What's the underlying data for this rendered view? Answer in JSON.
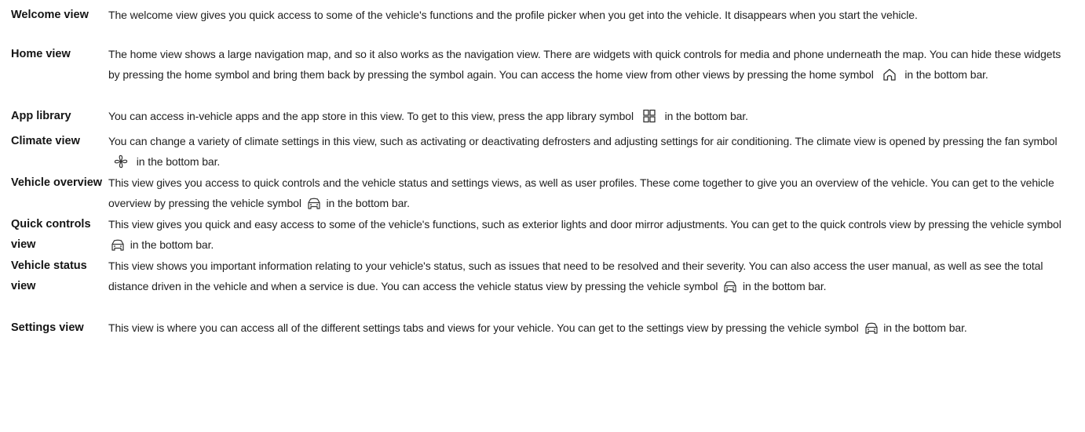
{
  "rows": [
    {
      "term": "Welcome view",
      "desc": "The welcome view gives you quick access to some of the vehicle's functions and the profile picker when you get into the vehicle. It disappears when you start the vehicle."
    },
    {
      "term": "Home view",
      "desc_before": "The home view shows a large navigation map, and so it also works as the navigation view. There are widgets with quick controls for media and phone underneath the map. You can hide these widgets by pressing the home symbol and bring them back by pressing the symbol again. You can access the home view from other views by pressing the home symbol",
      "icon": "home-icon",
      "desc_after": "in the bottom bar."
    },
    {
      "term": "App library",
      "desc_before": "You can access in-vehicle apps and the app store in this view. To get to this view, press the app library symbol",
      "icon": "app-library-icon",
      "desc_after": "in the bottom bar."
    },
    {
      "term": "Climate view",
      "desc_before": "You can change a variety of climate settings in this view, such as activating or deactivating defrosters and adjusting settings for air conditioning. The climate view is opened by pressing the fan symbol",
      "icon": "fan-icon",
      "desc_after": "in the bottom bar."
    },
    {
      "term": "Vehicle overview",
      "desc_before": "This view gives you access to quick controls and the vehicle status and settings views, as well as user profiles. These come together to give you an overview of the vehicle. You can get to the vehicle overview by pressing the vehicle symbol",
      "icon": "vehicle-icon",
      "desc_after": "in the bottom bar."
    },
    {
      "term": "Quick controls view",
      "desc_before": "This view gives you quick and easy access to some of the vehicle's functions, such as exterior lights and door mirror adjustments. You can get to the quick controls view by pressing the vehicle symbol",
      "icon": "vehicle-icon",
      "desc_after": "in the bottom bar."
    },
    {
      "term": "Vehicle status view",
      "desc_before": "This view shows you important information relating to your vehicle's status, such as issues that need to be resolved and their severity. You can also access the user manual, as well as see the total distance driven in the vehicle and when a service is due. You can access the vehicle status view by pressing the vehicle symbol",
      "icon": "vehicle-icon",
      "desc_after": "in the bottom bar."
    },
    {
      "term": "Settings view",
      "desc_before": "This view is where you can access all of the different settings tabs and views for your vehicle. You can get to the settings view by pressing the vehicle symbol",
      "icon": "vehicle-icon",
      "desc_after": "in the bottom bar."
    }
  ]
}
